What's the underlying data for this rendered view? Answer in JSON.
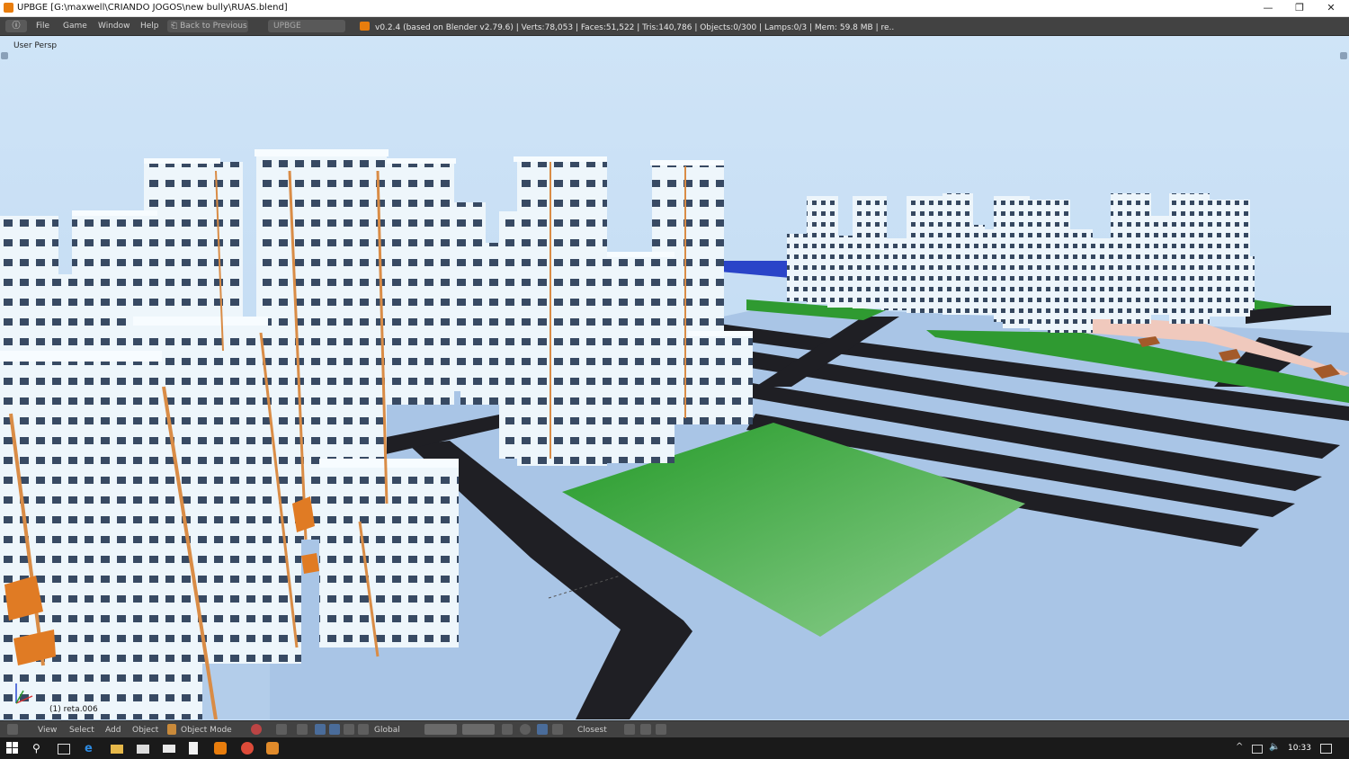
{
  "window": {
    "title": "UPBGE [G:\\maxwell\\CRIANDO JOGOS\\new bully\\RUAS.blend]",
    "minimize": "—",
    "maximize": "❐",
    "close": "✕"
  },
  "menubar": {
    "info_icon": "info-icon",
    "items": [
      "File",
      "Game",
      "Window",
      "Help"
    ],
    "back_button": "Back to Previous",
    "scene": "UPBGE",
    "stats": "v0.2.4 (based on Blender v2.79.6)  | Verts:78,053 | Faces:51,522 | Tris:140,786 | Objects:0/300 | Lamps:0/3 | Mem: 59.8 MB | re.."
  },
  "viewport": {
    "view_label": "User Persp",
    "object_label": "(1) reta.006"
  },
  "bottombar": {
    "view": "View",
    "select": "Select",
    "add": "Add",
    "object": "Object",
    "mode": "Object Mode",
    "orientation": "Global",
    "snap": "Closest"
  },
  "taskbar": {
    "time": "10:33"
  },
  "colors": {
    "sky": "#c4dcf3",
    "ground": "#a9c5e6",
    "road": "#1f1f24",
    "grass": "#2f9a31",
    "building": "#eef6fb",
    "trim": "#d98c46",
    "ui_dark": "#424242"
  }
}
